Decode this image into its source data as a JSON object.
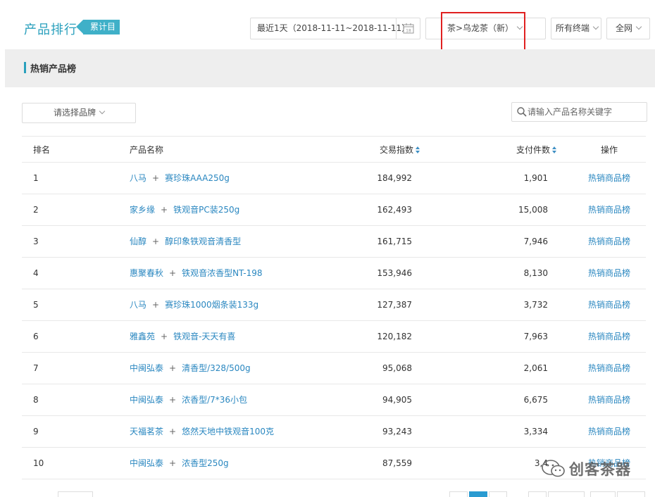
{
  "header": {
    "title": "产品排行",
    "badge": "累计目",
    "date_range": "最近1天（2018-11-11~2018-11-11）",
    "calendar_day": "18",
    "category": "茶>乌龙茶（新）",
    "terminal": "所有终端",
    "network": "全网"
  },
  "section": {
    "title": "热销产品榜"
  },
  "toolbar": {
    "brand_select": "请选择品牌",
    "search_placeholder": "请输入产品名称关键字"
  },
  "table": {
    "columns": [
      "排名",
      "产品名称",
      "交易指数",
      "支付件数",
      "操作"
    ],
    "rows": [
      {
        "rank": "1",
        "brand": "八马",
        "product": "赛珍珠AAA250g",
        "index": "184,992",
        "payments": "1,901",
        "action": "热销商品榜"
      },
      {
        "rank": "2",
        "brand": "家乡缘",
        "product": "铁观音PC装250g",
        "index": "162,493",
        "payments": "15,008",
        "action": "热销商品榜"
      },
      {
        "rank": "3",
        "brand": "仙醇",
        "product": "醇印象铁观音清香型",
        "index": "161,715",
        "payments": "7,946",
        "action": "热销商品榜"
      },
      {
        "rank": "4",
        "brand": "惠聚春秋",
        "product": "铁观音浓香型NT-198",
        "index": "153,946",
        "payments": "8,130",
        "action": "热销商品榜"
      },
      {
        "rank": "5",
        "brand": "八马",
        "product": "赛珍珠1000烟条装133g",
        "index": "127,387",
        "payments": "3,732",
        "action": "热销商品榜"
      },
      {
        "rank": "6",
        "brand": "雅鑫苑",
        "product": "铁观音-天天有喜",
        "index": "120,182",
        "payments": "7,963",
        "action": "热销商品榜"
      },
      {
        "rank": "7",
        "brand": "中闽弘泰",
        "product": "清香型/328/500g",
        "index": "95,068",
        "payments": "2,061",
        "action": "热销商品榜"
      },
      {
        "rank": "8",
        "brand": "中闽弘泰",
        "product": "浓香型/7*36小包",
        "index": "94,905",
        "payments": "6,675",
        "action": "热销商品榜"
      },
      {
        "rank": "9",
        "brand": "天福茗茶",
        "product": "悠然天地中铁观音100克",
        "index": "93,243",
        "payments": "3,334",
        "action": "热销商品榜"
      },
      {
        "rank": "10",
        "brand": "中闽弘泰",
        "product": "浓香型250g",
        "index": "87,559",
        "payments": "3,4",
        "action": "热销商品榜"
      }
    ]
  },
  "watermark": {
    "text": "创客茶器"
  },
  "colors": {
    "accent": "#2aa0bd",
    "link": "#2a87c0",
    "highlight_box": "#e02020"
  }
}
